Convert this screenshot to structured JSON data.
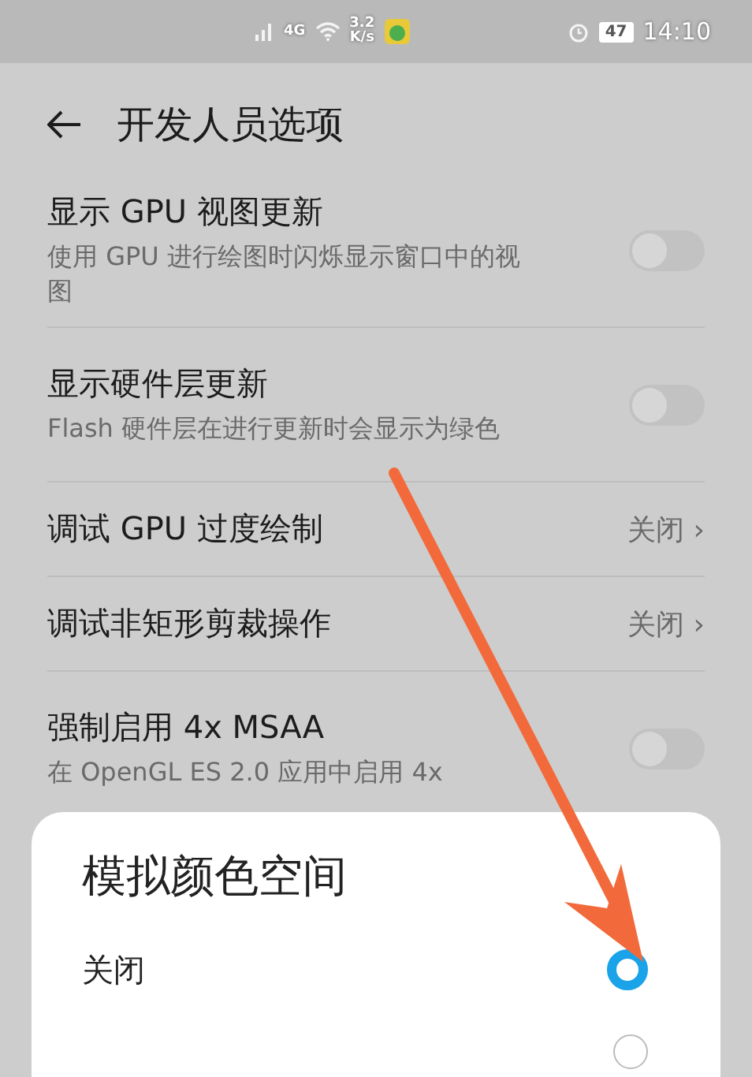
{
  "status_bar": {
    "network": "4G",
    "speed_value": "3.2",
    "speed_unit": "K/s",
    "battery": "47",
    "time": "14:10"
  },
  "header": {
    "title": "开发人员选项"
  },
  "settings": [
    {
      "kind": "switch",
      "title": "显示 GPU 视图更新",
      "summary": "使用 GPU 进行绘图时闪烁显示窗口中的视图",
      "on": false
    },
    {
      "kind": "switch",
      "title": "显示硬件层更新",
      "summary": "Flash 硬件层在进行更新时会显示为绿色",
      "on": false
    },
    {
      "kind": "choice",
      "title": "调试 GPU 过度绘制",
      "value": "关闭",
      "chevron": "›"
    },
    {
      "kind": "choice",
      "title": "调试非矩形剪裁操作",
      "value": "关闭",
      "chevron": "›"
    },
    {
      "kind": "switch",
      "title": "强制启用 4x MSAA",
      "summary": "在 OpenGL ES 2.0 应用中启用 4x",
      "on": false
    }
  ],
  "dialog": {
    "title": "模拟颜色空间",
    "options": [
      {
        "label": "关闭",
        "selected": true
      },
      {
        "selected": false
      }
    ]
  }
}
